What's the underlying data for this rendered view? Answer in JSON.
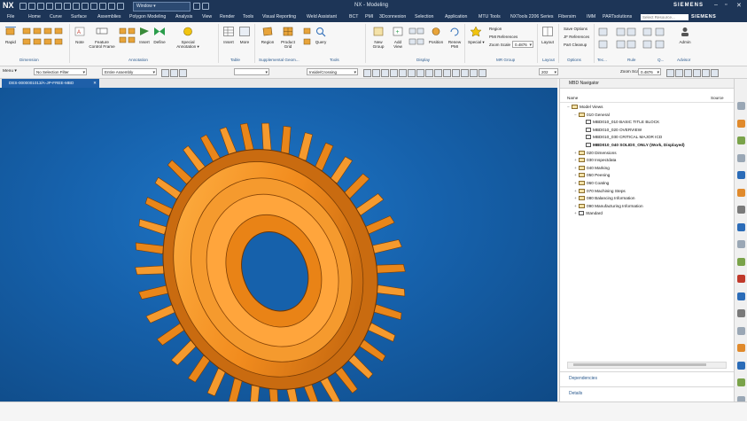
{
  "titlebar": {
    "logo": "NX",
    "window_menu": "Window ▾",
    "title": "NX - Modeling",
    "brand": "SIEMENS"
  },
  "menubar": {
    "items": [
      "File",
      "Home",
      "Curve",
      "Surface",
      "Assemblies",
      "Polygon Modeling",
      "Analysis",
      "View",
      "Render",
      "Tools",
      "Visual Reporting",
      "Weld Assistant",
      "BCT",
      "PMI",
      "3Dconnexion",
      "Selection",
      "Application",
      "MTU Tools",
      "NXTools 2206 Series",
      "Fibersim",
      "IMM",
      "PARTsolutions"
    ],
    "search_placeholder": "Select Resource...",
    "brand": "SIEMENS"
  },
  "ribbon": {
    "buttons": [
      "Rapid",
      "Note",
      "Feature Control Frame",
      "Insert",
      "Define",
      "Special Annotation ▾",
      "Insert",
      "More",
      "Region",
      "Product Grid",
      "Query",
      "New Group",
      "Add View",
      "Position",
      "Renew PMI",
      "Special ▾",
      "Layout",
      "Admin"
    ],
    "small_items": [
      "Region",
      "PMI References",
      "Zoom Scale",
      "0.4876",
      "Save Options",
      "JF References",
      "Part Cleanup"
    ],
    "groups": [
      "Dimension",
      "Annotation",
      "Table",
      "Supplemental Geom...",
      "Tools",
      "Display",
      "MR Group",
      "Layout",
      "Options",
      "Tec...",
      "Rule",
      "Q...",
      "Advisor"
    ]
  },
  "toolbar2": {
    "menu_label": "Menu ▾",
    "filter": "No Selection Filter",
    "assembly": "Entire Assembly",
    "mode": "Inside/Crossing",
    "zoom_label": "Zoom Scale",
    "zoom_value": "0.4876",
    "number": "202"
  },
  "document_tab": {
    "label": "DES-0000001013/A-JP-FREE-MBD"
  },
  "navigator": {
    "title": "MBD Navigator",
    "col_name": "Name",
    "col_source": "Source",
    "tree": [
      {
        "label": "Model Views",
        "depth": 0,
        "exp": "−",
        "kind": "fld",
        "bold": false
      },
      {
        "label": "010 General",
        "depth": 1,
        "exp": "−",
        "kind": "fld",
        "bold": false
      },
      {
        "label": "MBD010_010 BASIC TITLE BLOCK",
        "depth": 2,
        "exp": "",
        "kind": "view",
        "bold": false
      },
      {
        "label": "MBD010_020 OVERVIEW",
        "depth": 2,
        "exp": "",
        "kind": "view",
        "bold": false
      },
      {
        "label": "MBD010_030 CRITICAL MAJOR ICD",
        "depth": 2,
        "exp": "",
        "kind": "view",
        "bold": false
      },
      {
        "label": "MBD010_040 SOLIDS_ONLY (Work, Displayed)",
        "depth": 2,
        "exp": "",
        "kind": "view",
        "bold": true
      },
      {
        "label": "020 Dimensions",
        "depth": 1,
        "exp": "+",
        "kind": "fld",
        "bold": false
      },
      {
        "label": "030 Inspectdata",
        "depth": 1,
        "exp": "+",
        "kind": "fld",
        "bold": false
      },
      {
        "label": "040 Marking",
        "depth": 1,
        "exp": "+",
        "kind": "fld",
        "bold": false
      },
      {
        "label": "050 Peening",
        "depth": 1,
        "exp": "+",
        "kind": "fld",
        "bold": false
      },
      {
        "label": "060 Coating",
        "depth": 1,
        "exp": "+",
        "kind": "fld",
        "bold": false
      },
      {
        "label": "070 Machining Steps",
        "depth": 1,
        "exp": "+",
        "kind": "fld",
        "bold": false
      },
      {
        "label": "080 Balancing Information",
        "depth": 1,
        "exp": "+",
        "kind": "fld",
        "bold": false
      },
      {
        "label": "090 Manufacturing Information",
        "depth": 1,
        "exp": "+",
        "kind": "fld",
        "bold": false
      },
      {
        "label": "Standard",
        "depth": 1,
        "exp": "+",
        "kind": "view",
        "bold": false
      }
    ],
    "dependencies": "Dependencies",
    "details": "Details"
  },
  "colors": {
    "titlebar": "#1d3557",
    "part": "#f28c1e",
    "viewport": "#1661ab"
  }
}
